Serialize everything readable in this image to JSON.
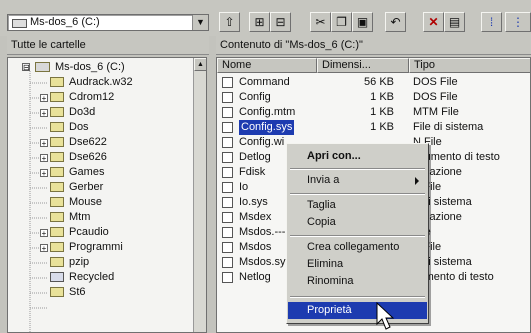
{
  "toolbar": {
    "drive": "Ms-dos_6 (C:)",
    "buttons": [
      "up-folder",
      "map-drive",
      "disconnect-drive",
      "cut",
      "copy",
      "paste",
      "undo",
      "delete",
      "properties",
      "large-icons",
      "small-icons"
    ]
  },
  "tree_panel": {
    "header": "Tutte le cartelle",
    "items": [
      {
        "label": "Ms-dos_6 (C:)",
        "expander": "⊟"
      },
      {
        "label": "Audrack.w32",
        "expander": ""
      },
      {
        "label": "Cdrom12",
        "expander": "+"
      },
      {
        "label": "Do3d",
        "expander": "+"
      },
      {
        "label": "Dos",
        "expander": ""
      },
      {
        "label": "Dse622",
        "expander": "+"
      },
      {
        "label": "Dse626",
        "expander": "+"
      },
      {
        "label": "Games",
        "expander": "+"
      },
      {
        "label": "Gerber",
        "expander": ""
      },
      {
        "label": "Mouse",
        "expander": ""
      },
      {
        "label": "Mtm",
        "expander": ""
      },
      {
        "label": "Pcaudio",
        "expander": "+"
      },
      {
        "label": "Programmi",
        "expander": "+"
      },
      {
        "label": "pzip",
        "expander": ""
      },
      {
        "label": "Recycled",
        "expander": ""
      },
      {
        "label": "St6",
        "expander": ""
      }
    ]
  },
  "list_panel": {
    "header": "Contenuto di \"Ms-dos_6 (C:)\"",
    "columns": [
      "Nome",
      "Dimensi...",
      "Tipo"
    ],
    "rows": [
      {
        "name": "Command",
        "size": "56 KB",
        "type": "DOS File"
      },
      {
        "name": "Config",
        "size": "1 KB",
        "type": "DOS File"
      },
      {
        "name": "Config.mtm",
        "size": "1 KB",
        "type": "MTM File"
      },
      {
        "name": "Config.sys",
        "size": "1 KB",
        "type": "File di sistema"
      },
      {
        "name": "Config.wi",
        "size": "",
        "type": "N File"
      },
      {
        "name": "Detlog",
        "size": "",
        "type": "ocumento di testo"
      },
      {
        "name": "Fdisk",
        "size": "",
        "type": "plicazione"
      },
      {
        "name": "Io",
        "size": "",
        "type": "S File"
      },
      {
        "name": "Io.sys",
        "size": "",
        "type": "e di sistema"
      },
      {
        "name": "Msdex",
        "size": "",
        "type": "plicazione"
      },
      {
        "name": "Msdos.---",
        "size": "",
        "type": "File"
      },
      {
        "name": "Msdos",
        "size": "",
        "type": "S File"
      },
      {
        "name": "Msdos.sy",
        "size": "",
        "type": "e di sistema"
      },
      {
        "name": "Netlog",
        "size": "",
        "type": "cumento di testo"
      }
    ]
  },
  "context_menu": {
    "open": "Apri con...",
    "send_to": "Invia a",
    "cut": "Taglia",
    "copy": "Copia",
    "create_link": "Crea collegamento",
    "delete": "Elimina",
    "rename": "Rinomina",
    "properties": "Proprietà"
  }
}
